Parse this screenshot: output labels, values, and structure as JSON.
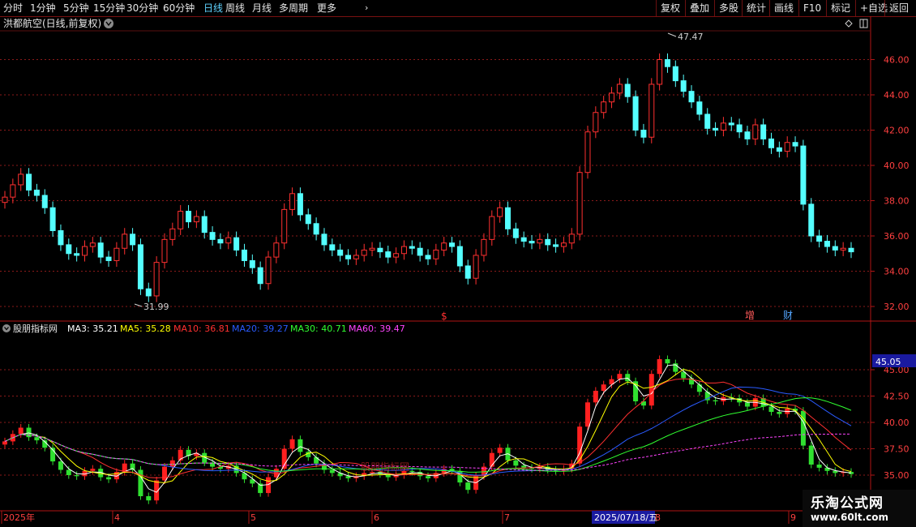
{
  "toolbar": {
    "left_items": [
      "分时",
      "1分钟",
      "5分钟",
      "15分钟",
      "30分钟",
      "60分钟",
      "日线",
      "周线",
      "月线",
      "多周期",
      "更多"
    ],
    "active_item": "日线",
    "right_items": [
      "复权",
      "叠加",
      "多股",
      "统计",
      "画线",
      "F10",
      "标记",
      "+自选",
      "返回"
    ]
  },
  "main_panel": {
    "stock_title": "洪都航空(日线,前复权)",
    "price_ticks": [
      "46.00",
      "44.00",
      "42.00",
      "40.00",
      "38.00",
      "36.00",
      "34.00",
      "32.00"
    ],
    "high_label": "47.47",
    "low_label": "31.99",
    "markers": {
      "dollar": "$",
      "zeng": "增",
      "cai": "财"
    }
  },
  "indicator_panel": {
    "name": "股朋指标网",
    "legend": [
      {
        "label": "MA3: 35.21",
        "color": "#ffffff"
      },
      {
        "label": "MA5: 35.28",
        "color": "#ffff00"
      },
      {
        "label": "MA10: 36.81",
        "color": "#ff3030"
      },
      {
        "label": "MA20: 39.27",
        "color": "#2a5bff"
      },
      {
        "label": "MA30: 40.71",
        "color": "#30ff30"
      },
      {
        "label": "MA60: 39.47",
        "color": "#ff44ff"
      }
    ],
    "price_ticks": [
      "45.00",
      "42.50",
      "40.00",
      "37.50",
      "35.00"
    ],
    "current_value": "45.05",
    "watermark_text": "股朋指标网"
  },
  "date_axis": {
    "labels": [
      "2025年",
      "4",
      "5",
      "6",
      "7",
      "8",
      "9"
    ],
    "cursor_date": "2025/07/18/五"
  },
  "logo": {
    "title": "乐淘公式网",
    "url": "www.60lt.com"
  },
  "colors": {
    "up": "#ff3030",
    "down": "#54ffff",
    "grid": "#8b1a1a",
    "axis": "#b01515"
  }
}
